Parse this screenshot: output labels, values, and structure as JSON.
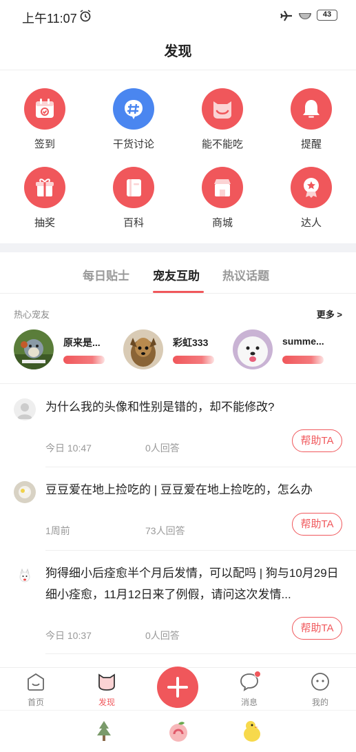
{
  "status_bar": {
    "time": "上午11:07",
    "battery": "43"
  },
  "header": {
    "title": "发现"
  },
  "feature_grid": [
    {
      "label": "签到",
      "icon": "calendar-icon"
    },
    {
      "label": "干货讨论",
      "icon": "hashtag-icon"
    },
    {
      "label": "能不能吃",
      "icon": "cat-face-icon"
    },
    {
      "label": "提醒",
      "icon": "bell-icon"
    },
    {
      "label": "抽奖",
      "icon": "gift-icon"
    },
    {
      "label": "百科",
      "icon": "book-icon"
    },
    {
      "label": "商城",
      "icon": "shop-icon"
    },
    {
      "label": "达人",
      "icon": "star-badge-icon"
    }
  ],
  "tabs": [
    "每日贴士",
    "宠友互助",
    "热议话题"
  ],
  "active_tab": "宠友互助",
  "friends": {
    "title": "热心宠友",
    "more": "更多 >",
    "items": [
      {
        "name": "原来是..."
      },
      {
        "name": "彩虹333"
      },
      {
        "name": "summe..."
      }
    ]
  },
  "questions": [
    {
      "text": "为什么我的头像和性别是错的，却不能修改?",
      "time": "今日 10:47",
      "answers": "0人回答",
      "button": "帮助TA"
    },
    {
      "text": "豆豆爱在地上捡吃的 | 豆豆爱在地上捡吃的，怎么办",
      "time": "1周前",
      "answers": "73人回答",
      "button": "帮助TA"
    },
    {
      "text": "狗得细小后痊愈半个月后发情，可以配吗 | 狗与10月29日细小痊愈，11月12日来了例假，请问这次发情...",
      "time": "今日 10:37",
      "answers": "0人回答",
      "button": "帮助TA"
    }
  ],
  "bottom_nav": [
    {
      "label": "首页",
      "icon": "home-icon"
    },
    {
      "label": "发现",
      "icon": "cat-icon",
      "active": true
    },
    {
      "label": "",
      "icon": "plus-icon"
    },
    {
      "label": "消息",
      "icon": "chat-bubble-icon",
      "badge": true
    },
    {
      "label": "我的",
      "icon": "smiley-icon"
    }
  ],
  "colors": {
    "accent": "#f0575b",
    "accent_light": "#f8eaea"
  }
}
